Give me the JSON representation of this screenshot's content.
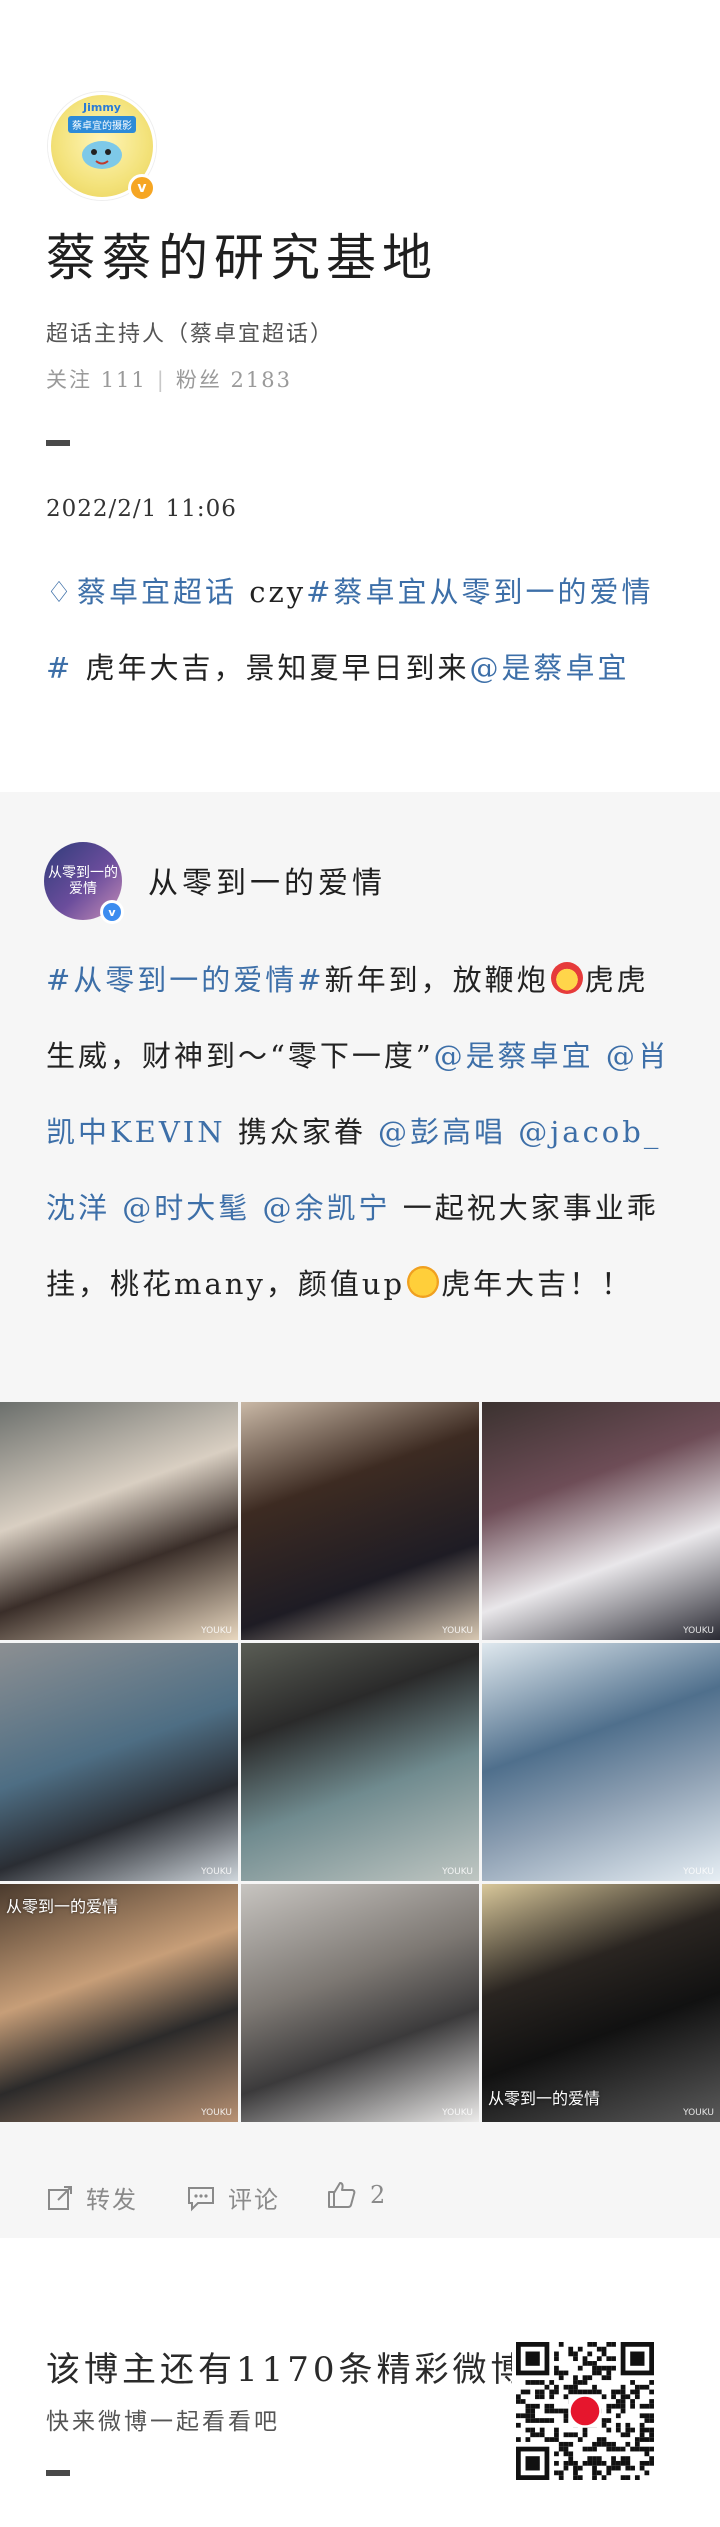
{
  "profile": {
    "avatar_text_top": "Jimmy",
    "avatar_text_mid": "蔡卓宜的摄影",
    "name": "蔡蔡的研究基地",
    "subtitle": "超话主持人（蔡卓宜超话）",
    "following_label": "关注",
    "following_count": "111",
    "fans_label": "粉丝",
    "fans_count": "2183"
  },
  "post": {
    "date": "2022/2/1  11:06",
    "text_parts": [
      {
        "type": "link",
        "text": "蔡卓宜超话"
      },
      {
        "type": "plain",
        "text": " czy"
      },
      {
        "type": "link",
        "text": "#蔡卓宜从零到一的爱情#"
      },
      {
        "type": "plain",
        "text": " 虎年大吉，景知夏早日到来"
      },
      {
        "type": "link",
        "text": "@是蔡卓宜"
      }
    ]
  },
  "repost": {
    "avatar_text": "从零到一的爱情",
    "author": "从零到一的爱情",
    "text_parts": [
      {
        "type": "link",
        "text": "#从零到一的爱情#"
      },
      {
        "type": "plain",
        "text": "新年到，放鞭炮"
      },
      {
        "type": "emoji",
        "name": "firecracker-emoji"
      },
      {
        "type": "plain",
        "text": "虎虎生威，财神到～“零下一度”"
      },
      {
        "type": "link",
        "text": "@是蔡卓宜"
      },
      {
        "type": "plain",
        "text": " "
      },
      {
        "type": "link",
        "text": "@肖凯中KEVIN"
      },
      {
        "type": "plain",
        "text": " 携众家眷 "
      },
      {
        "type": "link",
        "text": "@彭高唱"
      },
      {
        "type": "plain",
        "text": " "
      },
      {
        "type": "link",
        "text": "@jacob_沈洋"
      },
      {
        "type": "plain",
        "text": " "
      },
      {
        "type": "link",
        "text": "@时大髦"
      },
      {
        "type": "plain",
        "text": " "
      },
      {
        "type": "link",
        "text": "@余凯宁"
      },
      {
        "type": "plain",
        "text": " 一起祝大家事业乖挂，桃花many，颜值up"
      },
      {
        "type": "emoji",
        "name": "shock-emoji"
      },
      {
        "type": "plain",
        "text": "虎年大吉！！"
      }
    ],
    "photo_watermark": "YOUKU",
    "photo_overlays": [
      "",
      "",
      "",
      "",
      "",
      "",
      "从零到一的爱情",
      "",
      "从零到一的爱情"
    ]
  },
  "actions": {
    "repost_label": "转发",
    "comment_label": "评论",
    "like_count": "2"
  },
  "footer": {
    "title": "该博主还有1170条精彩微博",
    "subtitle": "快来微博一起看看吧"
  },
  "colors": {
    "link": "#3d6fa8",
    "muted": "#9a9a9a",
    "repost_bg": "#f6f6f6",
    "verified_gold": "#f6a623",
    "verified_blue": "#3c8cef"
  }
}
